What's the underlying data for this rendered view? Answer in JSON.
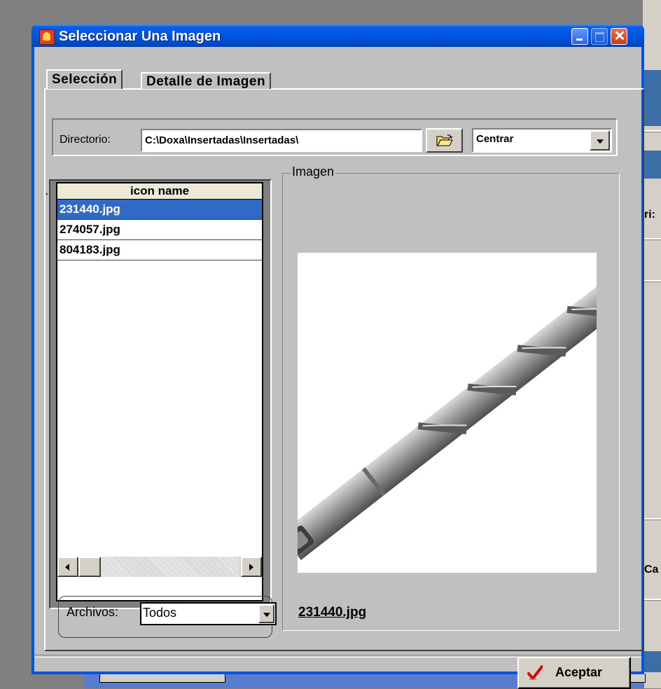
{
  "window": {
    "title": "Seleccionar Una Imagen",
    "icon": "app-icon"
  },
  "tabs": [
    {
      "label": "Selección",
      "selected": true
    },
    {
      "label": "Detalle de Imagen",
      "selected": false
    }
  ],
  "directory": {
    "label": "Directorio:",
    "value": "C:\\Doxa\\Insertadas\\Insertadas\\",
    "browse_icon": "open-folder-icon"
  },
  "alignment": {
    "selected": "Centrar"
  },
  "file_list": {
    "column_header": "icon name",
    "rows": [
      "231440.jpg",
      "274057.jpg",
      "804183.jpg"
    ],
    "selected_index": 0,
    "row_indicator": "*"
  },
  "filter": {
    "label": "Archivos:",
    "selected": "Todos"
  },
  "image_panel": {
    "label": "Imagen",
    "caption": "231440.jpg"
  },
  "buttons": {
    "ok_label": "Aceptar",
    "ok_icon": "checkmark-icon"
  },
  "background_fragments": {
    "right_1": "ri:",
    "right_2": "Ca"
  },
  "colors": {
    "title_bar": "#0054e3",
    "selection": "#316ac5",
    "dialog_face": "#c0c0c0"
  }
}
